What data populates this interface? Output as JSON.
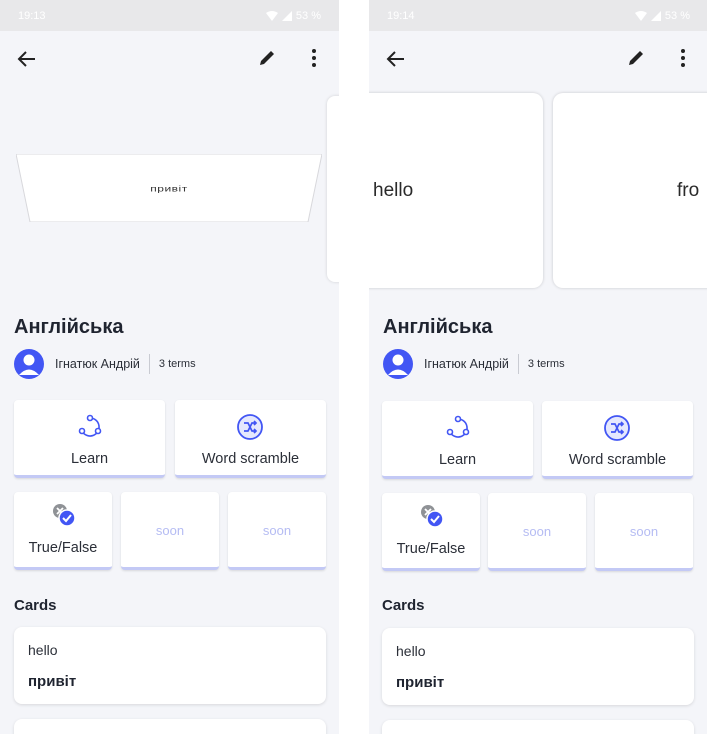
{
  "colors": {
    "accent": "#4256f4",
    "accent_light": "#c3c9f5",
    "soon_text": "#b5bcf3",
    "background": "#f4f5f9"
  },
  "screens": [
    {
      "status": {
        "time": "19:13",
        "battery": "53 %"
      },
      "carousel": {
        "visible_card_text": "привіт"
      },
      "set": {
        "title": "Англійська",
        "author": "Ігнатюк Андрій",
        "terms": "3 terms"
      },
      "modes": {
        "learn": "Learn",
        "word_scramble": "Word scramble",
        "true_false": "True/False",
        "soon1": "soon",
        "soon2": "soon"
      },
      "cards_section": {
        "heading": "Cards",
        "items": [
          {
            "term": "hello",
            "definition": "привіт"
          }
        ]
      }
    },
    {
      "status": {
        "time": "19:14",
        "battery": "53 %"
      },
      "carousel": {
        "card1_text": "hello",
        "card2_text": "fro"
      },
      "set": {
        "title": "Англійська",
        "author": "Ігнатюк Андрій",
        "terms": "3 terms"
      },
      "modes": {
        "learn": "Learn",
        "word_scramble": "Word scramble",
        "true_false": "True/False",
        "soon1": "soon",
        "soon2": "soon"
      },
      "cards_section": {
        "heading": "Cards",
        "items": [
          {
            "term": "hello",
            "definition": "привіт"
          }
        ]
      }
    }
  ],
  "icons": {
    "back": "arrow-left-icon",
    "edit": "pencil-icon",
    "more": "more-vertical-icon",
    "learn": "learn-cycle-icon",
    "scramble": "shuffle-icon",
    "true_false": "true-false-icon",
    "avatar": "user-avatar-icon"
  }
}
